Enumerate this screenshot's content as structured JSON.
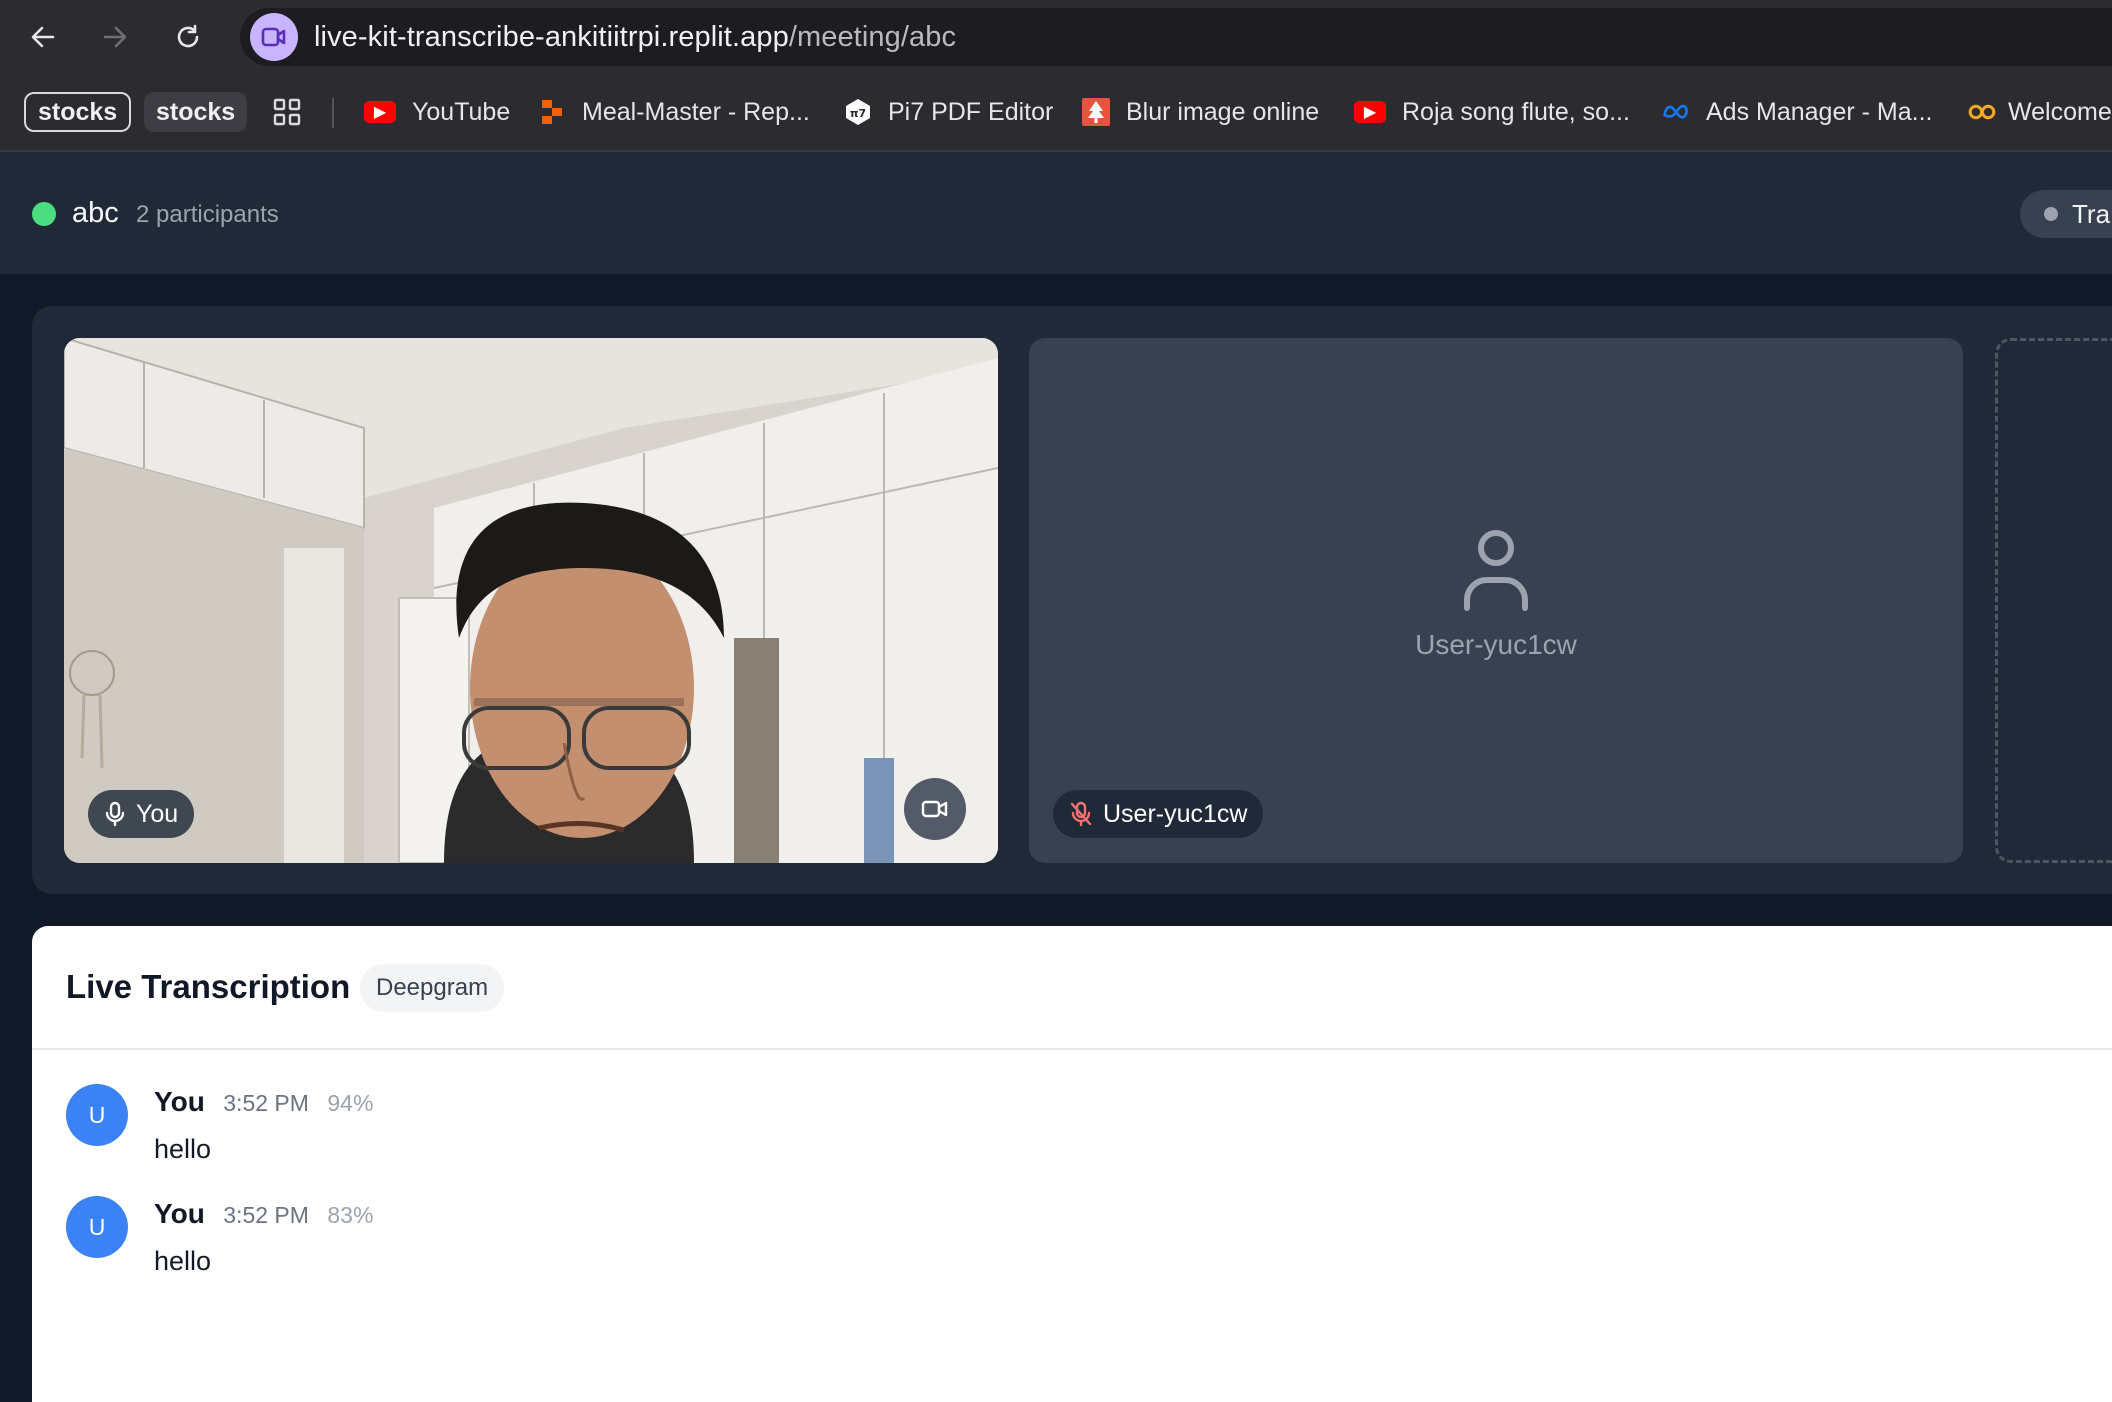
{
  "browser": {
    "url_host": "live-kit-transcribe-ankitiitrpi.replit.app",
    "url_path": "/meeting/abc",
    "bookmarks": {
      "chip1": "stocks",
      "chip2": "stocks",
      "items": [
        {
          "label": "YouTube",
          "icon": "youtube-icon",
          "color": "#ff0000"
        },
        {
          "label": "Meal-Master - Rep...",
          "icon": "replit-icon",
          "color": "#f26207"
        },
        {
          "label": "Pi7 PDF Editor",
          "icon": "pi7-icon",
          "color": "#ffffff"
        },
        {
          "label": "Blur image online",
          "icon": "tree-icon",
          "color": "#e8533f"
        },
        {
          "label": "Roja song flute, so...",
          "icon": "youtube-icon",
          "color": "#ff0000"
        },
        {
          "label": "Ads Manager - Ma...",
          "icon": "meta-icon",
          "color": "#1877f2"
        },
        {
          "label": "Welcome",
          "icon": "coursera-icon",
          "color": "#f5a623"
        }
      ]
    }
  },
  "meeting": {
    "room_name": "abc",
    "participants": "2 participants",
    "transcription_toggle": "Tra",
    "status_color": "#4ade80"
  },
  "tiles": {
    "local_label": "You",
    "remote_label": "User-yuc1cw",
    "remote_name": "User-yuc1cw"
  },
  "transcription": {
    "title": "Live Transcription",
    "provider": "Deepgram",
    "entries": [
      {
        "avatar": "U",
        "speaker": "You",
        "time": "3:52 PM",
        "confidence": "94%",
        "text": "hello"
      },
      {
        "avatar": "U",
        "speaker": "You",
        "time": "3:52 PM",
        "confidence": "83%",
        "text": "hello"
      }
    ]
  }
}
